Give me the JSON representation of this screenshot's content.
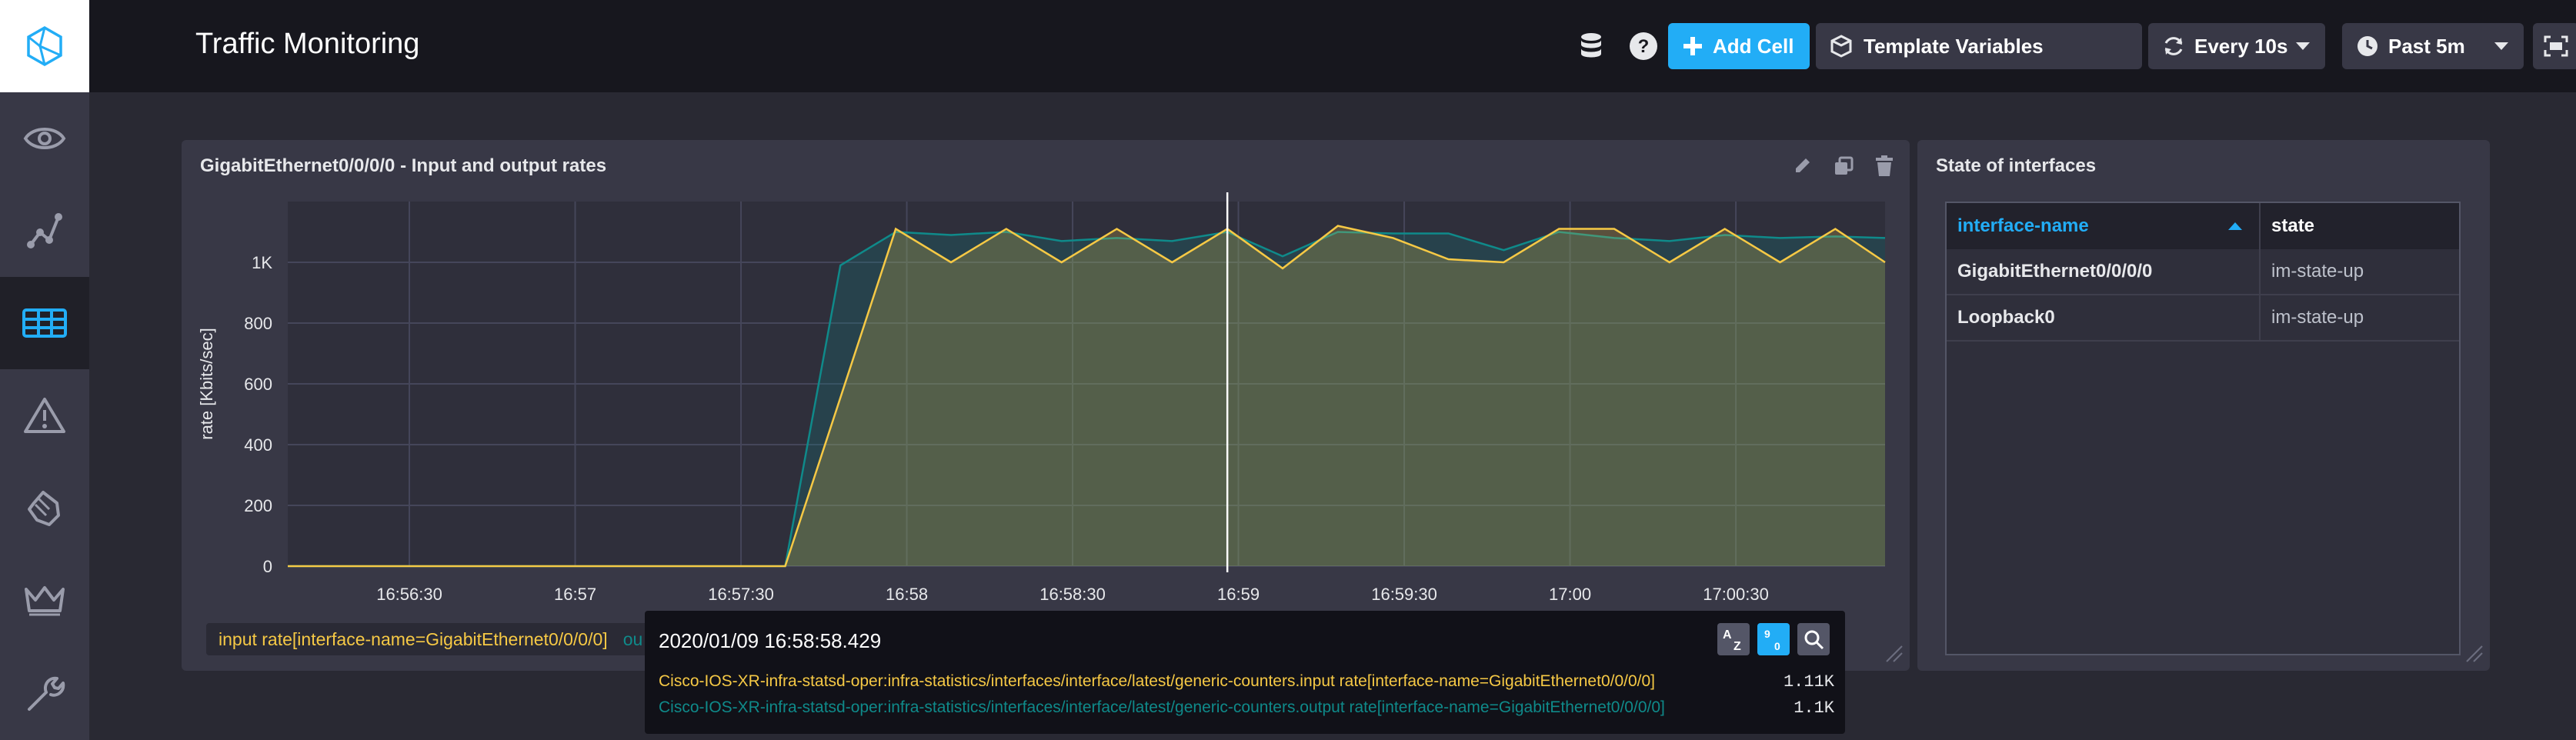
{
  "app": {
    "page_title": "Traffic Monitoring"
  },
  "header": {
    "add_cell_label": "Add Cell",
    "template_variables_label": "Template Variables",
    "refresh_label": "Every 10s",
    "time_range_label": "Past 5m"
  },
  "sidebar": {
    "items": [
      {
        "icon": "eye-icon",
        "active": false
      },
      {
        "icon": "graph-nodes-icon",
        "active": false
      },
      {
        "icon": "dashboards-grid-icon",
        "active": true
      },
      {
        "icon": "alert-triangle-icon",
        "active": false
      },
      {
        "icon": "hand-icon",
        "active": false
      },
      {
        "icon": "crown-icon",
        "active": false
      },
      {
        "icon": "wrench-icon",
        "active": false
      }
    ]
  },
  "graph_cell": {
    "title": "GigabitEthernet0/0/0/0 - Input and output rates",
    "legend_text": "input rate[interface-name=GigabitEthernet0/0/0/0]",
    "legend_peek": "ou",
    "tooltip": {
      "time": "2020/01/09 16:58:58.429",
      "rows": [
        {
          "label": "Cisco-IOS-XR-infra-statsd-oper:infra-statistics/interfaces/interface/latest/generic-counters.input rate[interface-name=GigabitEthernet0/0/0/0]",
          "value": "1.11K",
          "color": "#f6c945"
        },
        {
          "label": "Cisco-IOS-XR-infra-statsd-oper:infra-statistics/interfaces/interface/latest/generic-counters.output rate[interface-name=GigabitEthernet0/0/0/0]",
          "value": "1.1K",
          "color": "#0f8a8a"
        }
      ],
      "sort_alpha_label": "AZ",
      "sort_num_label": "90"
    }
  },
  "chart_data": {
    "type": "area",
    "ylabel": "rate [Kbits/sec]",
    "ylim": [
      0,
      1200
    ],
    "yticks": [
      0,
      200,
      400,
      600,
      800,
      1000
    ],
    "ytick_labels": [
      "0",
      "200",
      "400",
      "600",
      "800",
      "1K"
    ],
    "xticks": [
      "16:56:30",
      "16:57",
      "16:57:30",
      "16:58",
      "16:58:30",
      "16:59",
      "16:59:30",
      "17:00",
      "17:00:30"
    ],
    "x_start": "16:56:08",
    "x_end": "17:00:57",
    "hover_time": "16:58:58",
    "series": [
      {
        "name": "output rate[interface-name=GigabitEthernet0/0/0/0]",
        "color": "#0f8a8a",
        "points": [
          [
            "16:56:08",
            0
          ],
          [
            "16:57:38",
            0
          ],
          [
            "16:57:48",
            990
          ],
          [
            "16:57:58",
            1100
          ],
          [
            "16:58:08",
            1090
          ],
          [
            "16:58:18",
            1100
          ],
          [
            "16:58:28",
            1070
          ],
          [
            "16:58:38",
            1080
          ],
          [
            "16:58:48",
            1070
          ],
          [
            "16:58:58",
            1100
          ],
          [
            "16:59:08",
            1020
          ],
          [
            "16:59:18",
            1100
          ],
          [
            "16:59:28",
            1095
          ],
          [
            "16:59:38",
            1095
          ],
          [
            "16:59:48",
            1040
          ],
          [
            "16:59:58",
            1100
          ],
          [
            "17:00:08",
            1080
          ],
          [
            "17:00:18",
            1070
          ],
          [
            "17:00:28",
            1090
          ],
          [
            "17:00:38",
            1080
          ],
          [
            "17:00:48",
            1085
          ],
          [
            "17:00:57",
            1080
          ]
        ]
      },
      {
        "name": "input rate[interface-name=GigabitEthernet0/0/0/0]",
        "color": "#f6c945",
        "points": [
          [
            "16:56:08",
            0
          ],
          [
            "16:57:38",
            0
          ],
          [
            "16:57:58",
            1110
          ],
          [
            "16:58:08",
            1000
          ],
          [
            "16:58:18",
            1110
          ],
          [
            "16:58:28",
            1000
          ],
          [
            "16:58:38",
            1110
          ],
          [
            "16:58:48",
            1000
          ],
          [
            "16:58:58",
            1110
          ],
          [
            "16:59:08",
            980
          ],
          [
            "16:59:18",
            1120
          ],
          [
            "16:59:28",
            1080
          ],
          [
            "16:59:38",
            1010
          ],
          [
            "16:59:48",
            1000
          ],
          [
            "16:59:58",
            1110
          ],
          [
            "17:00:08",
            1110
          ],
          [
            "17:00:18",
            1000
          ],
          [
            "17:00:28",
            1110
          ],
          [
            "17:00:38",
            1000
          ],
          [
            "17:00:48",
            1110
          ],
          [
            "17:00:57",
            1000
          ]
        ]
      }
    ]
  },
  "table_cell": {
    "title": "State of interfaces",
    "columns": [
      "interface-name",
      "state"
    ],
    "rows": [
      [
        "GigabitEthernet0/0/0/0",
        "im-state-up"
      ],
      [
        "Loopback0",
        "im-state-up"
      ]
    ]
  }
}
